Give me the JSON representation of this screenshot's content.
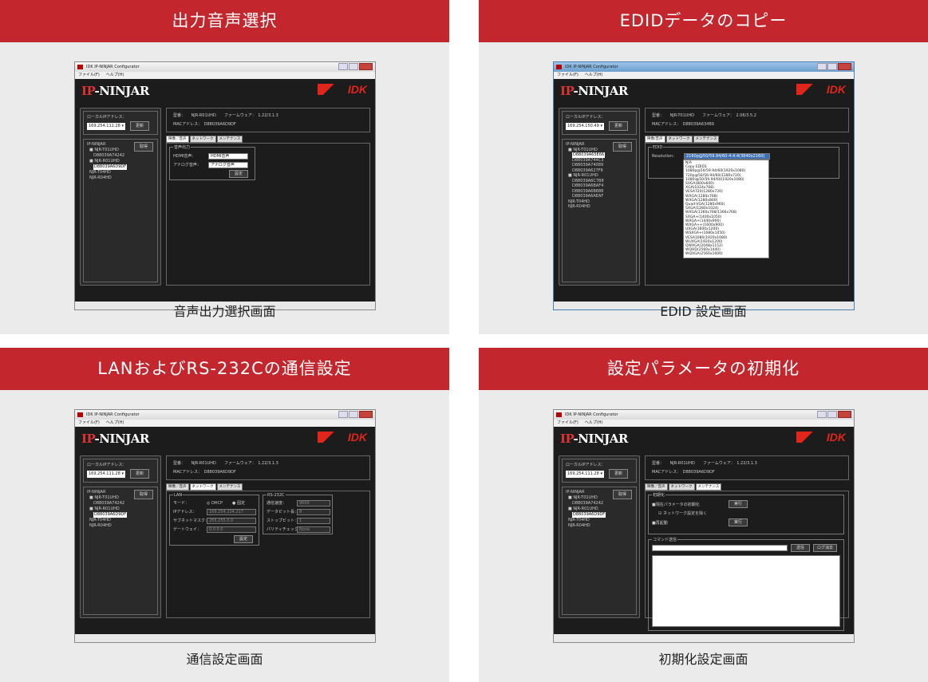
{
  "panels": [
    {
      "header": "出力音声選択",
      "caption": "音声出力選択画面",
      "window": {
        "title": "IDK IP-NINJAR Configurator",
        "menu": [
          "ファイル(F)",
          "ヘルプ(H)"
        ],
        "ip_label": "ローカルIPアドレス：",
        "ip_value": "169.254.111.28",
        "update_button": "更新",
        "tree_root": "IP-NINJAR",
        "get_button": "取得",
        "tree": [
          "■ NJR-T01UHD",
          "D88039A74242",
          "■ NJR-R01UHD",
          "D88039A6D9DF",
          "NJR-T04HD",
          "NJR-R04HD"
        ],
        "info_model": "型番：　　NJR-R01UHD　　ファームウェア：　1.22/3.1.3",
        "info_mac": "MACアドレス：　D88039A6D9DF",
        "tabs": [
          "映像／音声",
          "ネットワーク",
          "メンテナンス"
        ],
        "group_title": "音声出力",
        "hdmi_label": "HDMI音声：",
        "hdmi_value": "HDMI音声",
        "analog_label": "アナログ音声：",
        "analog_value": "アナログ音声",
        "set_button": "設定"
      }
    },
    {
      "header": "EDIDデータのコピー",
      "caption": "EDID 設定画面",
      "window": {
        "title": "IDK IP-NINJAR Configurator",
        "menu": [
          "ファイル(F)",
          "ヘルプ(H)"
        ],
        "ip_label": "ローカルIPアドレス：",
        "ip_value": "169.254.150.49",
        "update_button": "更新",
        "tree_root": "IP-NINJAR",
        "get_button": "取得",
        "tree": [
          "■ NJR-T01UHD",
          "D88039A65E66",
          "D88039A744C3",
          "D88039A74089",
          "D88039A627F6",
          "■ NJR-R01UHD",
          "D88039A6C7B8",
          "D88039A6BAF4",
          "D88039A6B888",
          "D88039A6AEAF",
          "NJR-T04HD",
          "NJR-R04HD"
        ],
        "info_model": "型番：　　NJR-T01UHD　　ファームウェア：　2.06/3.5.2",
        "info_mac": "MACアドレス：　D88039A634B9",
        "tabs": [
          "映像/音声",
          "ネットワーク",
          "メンテナンス"
        ],
        "group_title": "EDID",
        "resolution_label": "Resolution：",
        "resolution_value": "2160p@50/59.94/60-4:4:4(3840x2160)",
        "options": [
          "N/A",
          "Copy EDID1",
          "1080p@50/59.94/60(1920x1080)",
          "720p@50/59.94/60(1280x720)",
          "1080i@50/59.94/60(1920x1080)",
          "SVGA(800x600)",
          "XGA(1024x768)",
          "VESA720(1280x720)",
          "WXGA(1280x768)",
          "WXGA(1280x800)",
          "Quad-VGA(1280x960)",
          "SXGA(1280x1024)",
          "WXGA(1360x768/1366x768)",
          "SXGA+(1400x1050)",
          "WXGA+(1440x900)",
          "WXGA++(1600x900)",
          "UXGA(1600x1200)",
          "WSXGA+(1680x1050)",
          "VESA1080(1920x1080)",
          "WUXGA(1920x1200)",
          "QWXGA(2048x1152)",
          "WQHD(2560x1440)",
          "WQXGA(2560x1600)"
        ]
      }
    },
    {
      "header": "LANおよびRS-232Cの通信設定",
      "caption": "通信設定画面",
      "window": {
        "title": "IDK IP-NINJAR Configurator",
        "menu": [
          "ファイル(F)",
          "ヘルプ(H)"
        ],
        "ip_label": "ローカルIPアドレス：",
        "ip_value": "169.254.111.28",
        "update_button": "更新",
        "tree_root": "IP-NINJAR",
        "get_button": "取得",
        "tree": [
          "■ NJR-T01UHD",
          "D88039A74242",
          "■ NJR-R01UHD",
          "D88039A6D9DF",
          "NJR-T04HD",
          "NJR-R04HD"
        ],
        "info_model": "型番：　　NJR-R01UHD　　ファームウェア：　1.22/3.1.3",
        "info_mac": "MACアドレス：　D88039A6D9DF",
        "tabs": [
          "映像／音声",
          "ネットワーク",
          "メンテナンス"
        ],
        "lan_title": "LAN",
        "mode_label": "モード：",
        "dhcp": "◎ DHCP",
        "fixed": "● 固定",
        "ip_addr_label": "IPアドレス：",
        "ip_addr": "169.254.224.217",
        "subnet_label": "サブネットマスク：",
        "subnet": "255.255.0.0",
        "gateway_label": "ゲートウェイ：",
        "gateway": "0.0.0.0",
        "set_button": "設定",
        "rs_title": "RS-232C",
        "baud_label": "通信速度：",
        "baud": "9600",
        "data_label": "データビット長：",
        "data": "8",
        "stop_label": "ストップビット：",
        "stop": "1",
        "parity_label": "パリティチェック：",
        "parity": "None"
      }
    },
    {
      "header": "設定パラメータの初期化",
      "caption": "初期化設定画面",
      "window": {
        "title": "IDK IP-NINJAR Configurator",
        "menu": [
          "ファイル(F)",
          "ヘルプ(H)"
        ],
        "ip_label": "ローカルIPアドレス：",
        "ip_value": "169.254.111.28",
        "update_button": "更新",
        "tree_root": "IP-NINJAR",
        "get_button": "取得",
        "tree": [
          "■ NJR-T01UHD",
          "D88039A74242",
          "■ NJR-R01UHD",
          "D88039A6D9DF",
          "NJR-T04HD",
          "NJR-R04HD"
        ],
        "info_model": "型番：　　NJR-R01UHD　　ファームウェア：　1.22/3.1.3",
        "info_mac": "MACアドレス：　D88039A6D9DF",
        "tabs": [
          "映像／音声",
          "ネットワーク",
          "メンテナンス"
        ],
        "init_title": "初期化",
        "init_label": "■現在パラメータの初期化",
        "keep_network": "☑ ネットワーク設定を除く",
        "reboot_label": "■再起動",
        "run_button": "実行",
        "run_button2": "実行",
        "cmd_title": "コマンド送信",
        "send_button": "送信",
        "clear_log_button": "ログ消去"
      }
    }
  ]
}
